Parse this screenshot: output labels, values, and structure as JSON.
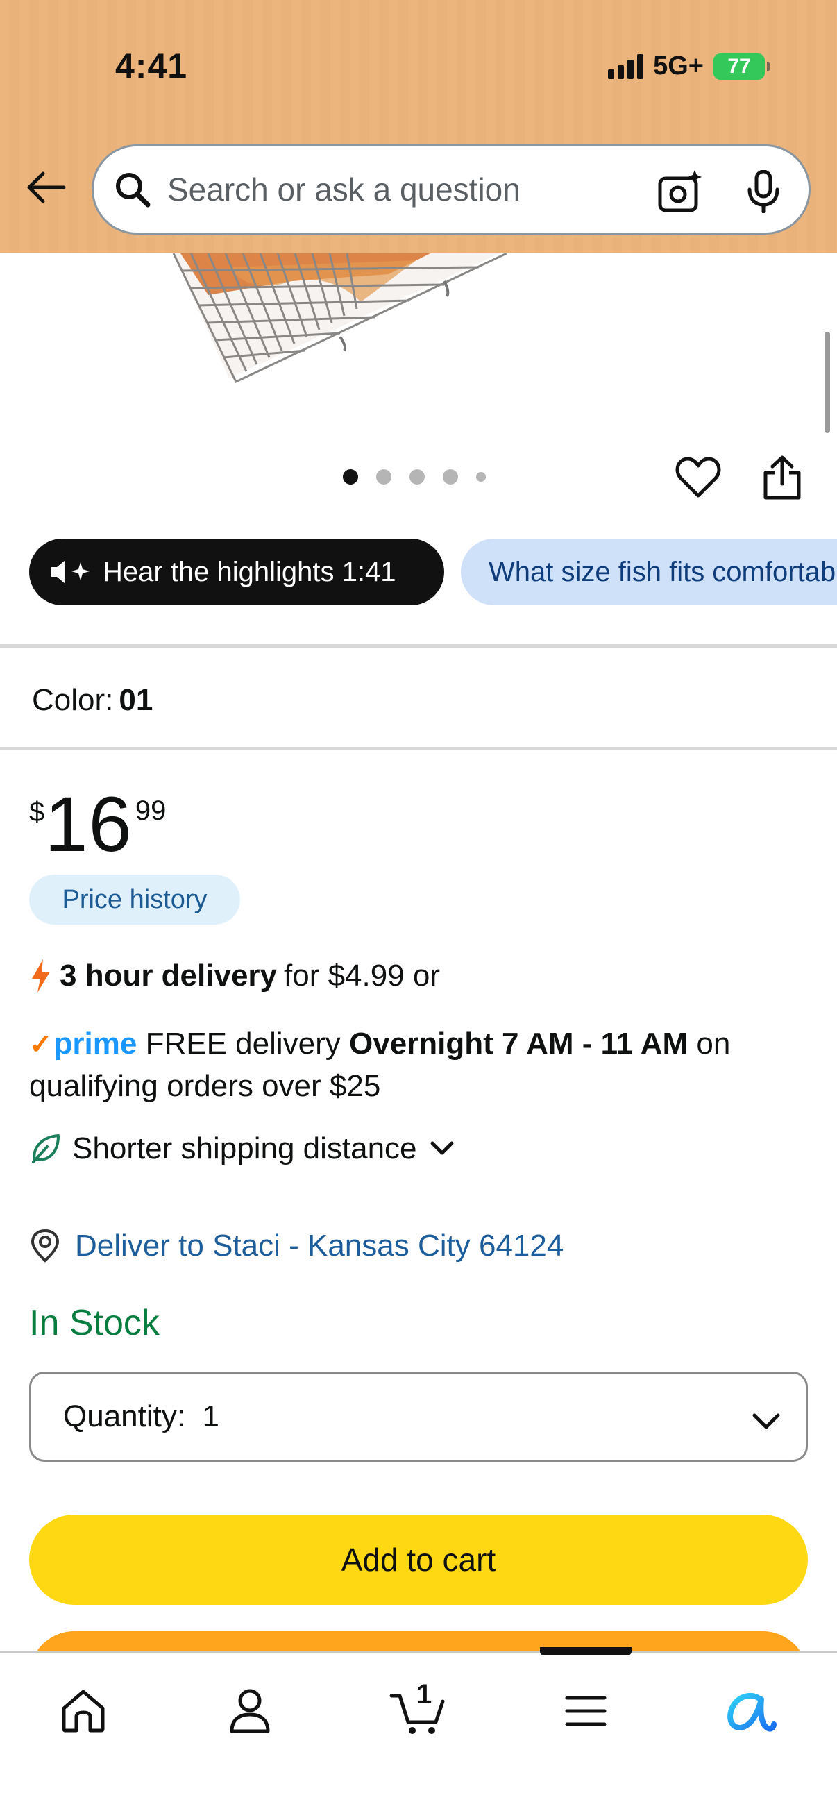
{
  "status_bar": {
    "time": "4:41",
    "network": "5G+",
    "battery": "77"
  },
  "search": {
    "placeholder": "Search or ask a question"
  },
  "chips": {
    "hear_label": "Hear the highlights 1:41",
    "question": "What size fish fits comfortably"
  },
  "variation": {
    "label": "Color:",
    "value": "01"
  },
  "price": {
    "currency": "$",
    "whole": "16",
    "fraction": "99",
    "history_label": "Price history"
  },
  "fast_delivery": {
    "bold": "3 hour delivery",
    "rest": "for $4.99 or"
  },
  "prime_delivery": {
    "logo": "prime",
    "text_before": "FREE delivery",
    "bold": "Overnight 7 AM - 11 AM",
    "text_after": "on qualifying orders over $25"
  },
  "shipping": {
    "label": "Shorter shipping distance"
  },
  "deliver_to": {
    "label": "Deliver to Staci - Kansas City 64124"
  },
  "stock": {
    "label": "In Stock"
  },
  "quantity": {
    "label": "Quantity:",
    "value": "1"
  },
  "buttons": {
    "add_to_cart": "Add to cart"
  },
  "nav": {
    "cart_count": "1"
  },
  "image_dots": {
    "count": 5,
    "active_index": 0
  },
  "colors": {
    "header_bg": "#ebb57d",
    "add_to_cart": "#ffd814",
    "buy_now": "#ffa41c",
    "in_stock": "#067d3e",
    "link": "#1d5d9b",
    "prime": "#1a98ff"
  }
}
